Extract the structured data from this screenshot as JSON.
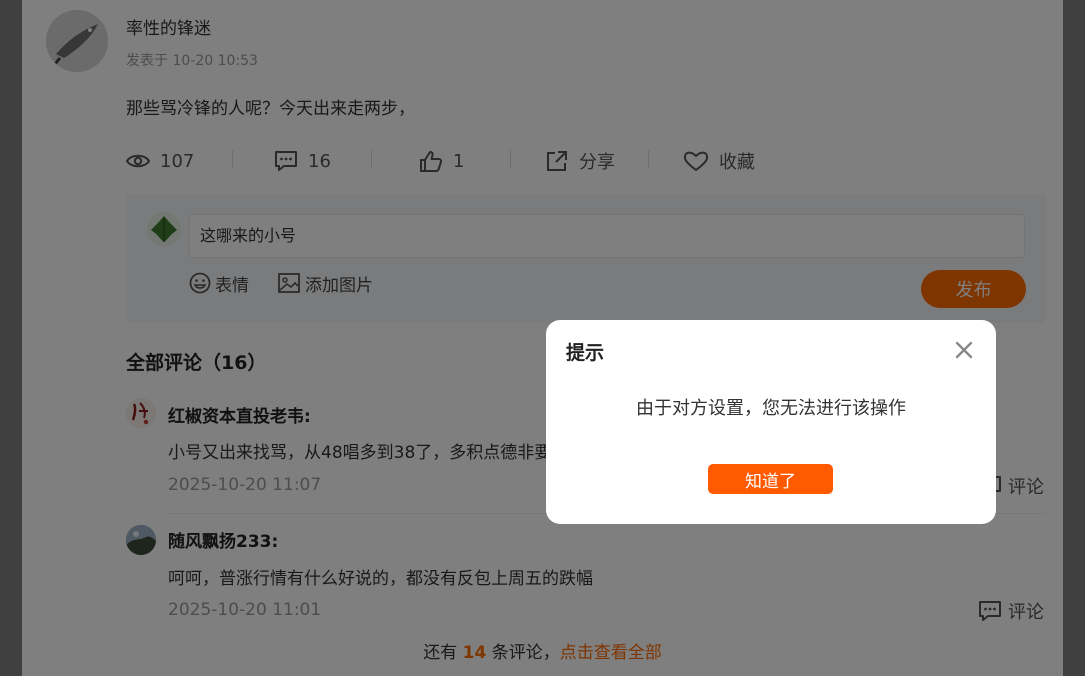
{
  "post": {
    "author": "率性的锋迷",
    "time": "发表于 10-20 10:53",
    "content": "那些骂冷锋的人呢？今天出来走两步，",
    "stats": {
      "views": "107",
      "comments": "16",
      "likes": "1",
      "share_label": "分享",
      "favorite_label": "收藏"
    }
  },
  "comment_box": {
    "input_value": "这哪来的小号",
    "emoji_label": "表情",
    "image_label": "添加图片",
    "publish_label": "发布"
  },
  "comments_section": {
    "title": "全部评论（16）",
    "items": [
      {
        "name": "红椒资本直投老韦:",
        "text": "小号又出来找骂，从48唱多到38了，多积点德非要",
        "time": "2025-10-20 11:07",
        "reply_label": "评论"
      },
      {
        "name": "随风飘扬233:",
        "text": "呵呵，普涨行情有什么好说的，都没有反包上周五的跌幅",
        "time": "2025-10-20 11:01",
        "reply_label": "评论"
      }
    ],
    "more_prefix": "还有 ",
    "more_count": "14",
    "more_suffix": " 条评论，",
    "more_link": "点击查看全部"
  },
  "dialog": {
    "title": "提示",
    "message": "由于对方设置，您无法进行该操作",
    "confirm_label": "知道了"
  },
  "colors": {
    "accent": "#ff6a00",
    "overlay": "rgba(0,0,0,0.5)"
  }
}
